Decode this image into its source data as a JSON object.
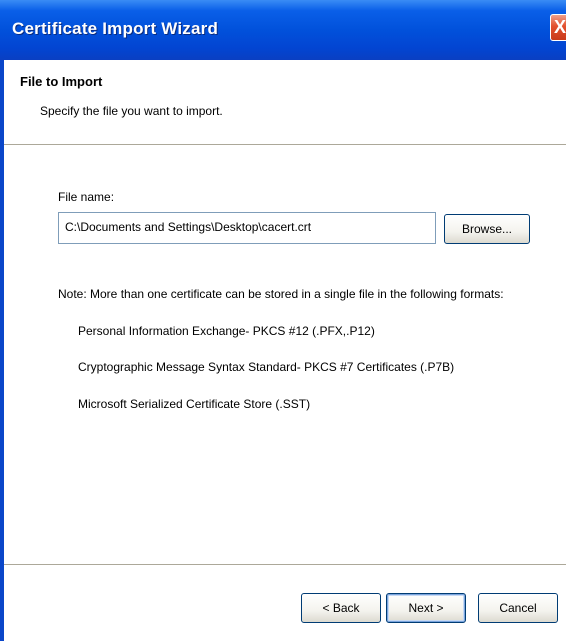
{
  "window": {
    "title": "Certificate Import Wizard",
    "close_symbol": "X"
  },
  "header": {
    "title": "File to Import",
    "subtitle": "Specify the file you want to import."
  },
  "file": {
    "label": "File name:",
    "value": "C:\\Documents and Settings\\Desktop\\cacert.crt",
    "browse_label": "Browse..."
  },
  "note": {
    "text": "Note:  More than one certificate can be stored in a single file in the following formats:",
    "formats": [
      "Personal Information Exchange- PKCS #12 (.PFX,.P12)",
      "Cryptographic Message Syntax Standard- PKCS #7 Certificates (.P7B)",
      "Microsoft Serialized Certificate Store (.SST)"
    ]
  },
  "footer": {
    "back_label": "< Back",
    "next_label": "Next >",
    "cancel_label": "Cancel"
  },
  "colors": {
    "title_bar": "#0151db",
    "close_button": "#e2502e",
    "dialog_bg": "#ffffff"
  }
}
